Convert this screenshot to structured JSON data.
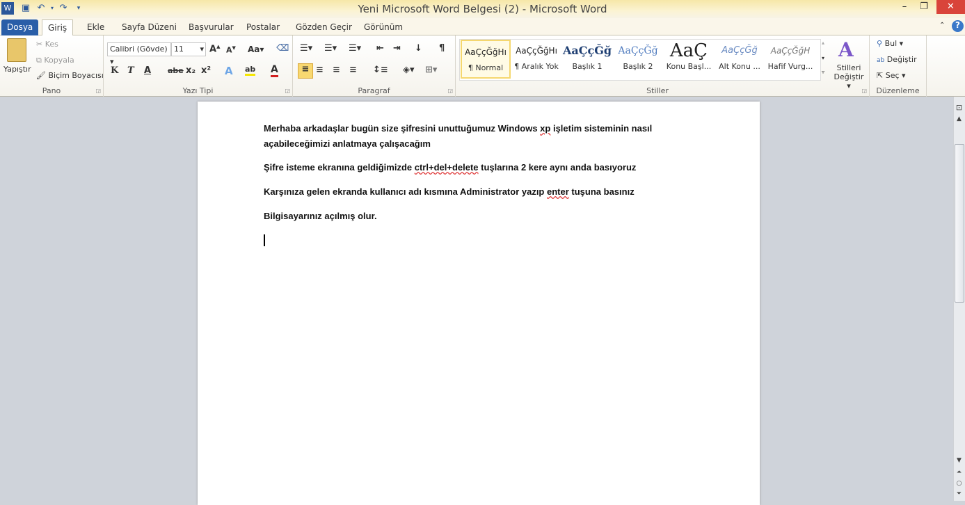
{
  "window": {
    "title": "Yeni Microsoft Word Belgesi (2) - Microsoft Word",
    "app_icon": "W"
  },
  "tabs": [
    {
      "label": "Dosya"
    },
    {
      "label": "Giriş"
    },
    {
      "label": "Ekle"
    },
    {
      "label": "Sayfa Düzeni"
    },
    {
      "label": "Başvurular"
    },
    {
      "label": "Postalar"
    },
    {
      "label": "Gözden Geçir"
    },
    {
      "label": "Görünüm"
    }
  ],
  "ribbon": {
    "clipboard": {
      "label": "Pano",
      "paste": "Yapıştır",
      "cut": "Kes",
      "copy": "Kopyala",
      "format_painter": "Biçim Boyacısı"
    },
    "font": {
      "label": "Yazı Tipi",
      "font_name": "Calibri (Gövde)",
      "font_size": "11",
      "bold": "K",
      "italic": "T",
      "underline": "A",
      "strike": "abe",
      "sub": "x₂",
      "sup": "x²",
      "change_case": "Aa"
    },
    "paragraph": {
      "label": "Paragraf"
    },
    "styles": {
      "label": "Stiller",
      "items": [
        {
          "preview": "AaÇçĞğHı",
          "name": "¶ Normal"
        },
        {
          "preview": "AaÇçĞğHı",
          "name": "¶ Aralık Yok"
        },
        {
          "preview": "AaÇçĞğ",
          "name": "Başlık 1"
        },
        {
          "preview": "AaÇçĞğ",
          "name": "Başlık 2"
        },
        {
          "preview": "AaÇ",
          "name": "Konu Başl..."
        },
        {
          "preview": "AaÇçĞğ",
          "name": "Alt Konu ..."
        },
        {
          "preview": "AaÇçĞğH",
          "name": "Hafif Vurg..."
        }
      ],
      "change_styles": "Stilleri Değiştir"
    },
    "editing": {
      "label": "Düzenleme",
      "find": "Bul",
      "replace": "Değiştir",
      "select": "Seç"
    }
  },
  "document": {
    "paragraphs": [
      "Merhaba arkadaşlar bugün size şifresini unuttuğumuz Windows xp işletim sisteminin nasıl açabileceğimizi anlatmaya çalışacağım",
      "Şifre isteme ekranına geldiğimizde ctrl+del+delete tuşlarına 2 kere aynı anda  basıyoruz",
      "Karşınıza gelen ekranda kullanıcı adı kısmına Administrator yazıp enter tuşuna basınız",
      "Bilgisayarınız açılmış olur."
    ]
  },
  "colors": {
    "file_tab": "#2a5ea8",
    "close": "#d9443a",
    "selected_style": "#f5d76e"
  }
}
